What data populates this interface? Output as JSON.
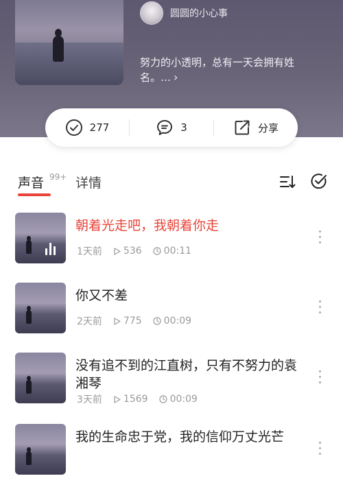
{
  "header": {
    "author_name": "圆圆的小心事",
    "description": "努力的小透明，总有一天会拥有姓名。…"
  },
  "stats": {
    "likes": "277",
    "comments": "3",
    "share_label": "分享"
  },
  "tabs": {
    "sound_label": "声音",
    "sound_count": "99+",
    "detail_label": "详情"
  },
  "tracks": [
    {
      "title": "朝着光走吧，我朝着你走",
      "age": "1天前",
      "plays": "536",
      "duration": "00:11",
      "active": true
    },
    {
      "title": "你又不差",
      "age": "2天前",
      "plays": "775",
      "duration": "00:09",
      "active": false
    },
    {
      "title": "没有追不到的江直树，只有不努力的袁湘琴",
      "age": "3天前",
      "plays": "1569",
      "duration": "00:09",
      "active": false
    },
    {
      "title": "我的生命忠于党，我的信仰万丈光芒",
      "age": "",
      "plays": "",
      "duration": "",
      "active": false
    }
  ],
  "colors": {
    "accent": "#e8443a",
    "header_bg": "#6a6478"
  },
  "icons": {
    "like": "check-circle-icon",
    "comment": "chat-bubble-icon",
    "share": "share-arrow-icon",
    "sort": "sort-icon",
    "select": "check-circle-icon",
    "play": "play-icon",
    "duration": "clock-icon",
    "more": "more-vertical-icon"
  }
}
